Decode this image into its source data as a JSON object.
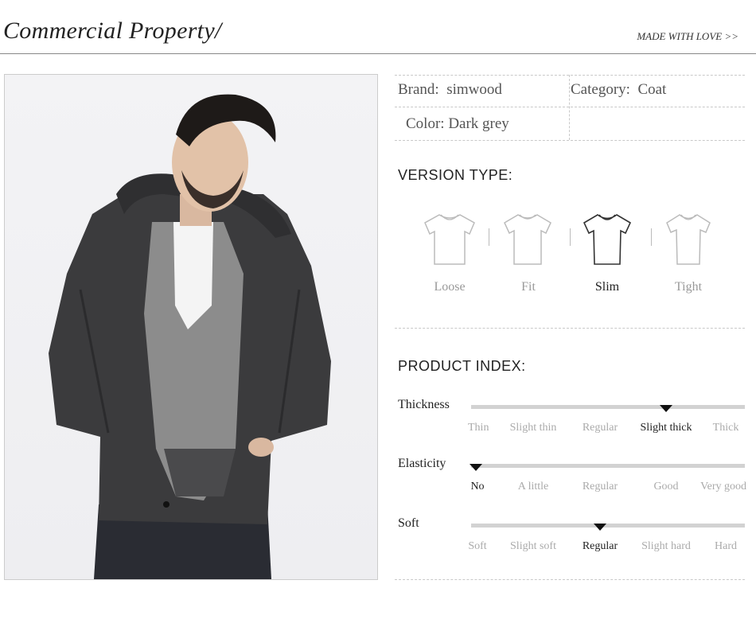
{
  "header": {
    "title": "Commercial Property/",
    "tagline": "MADE WITH LOVE >>"
  },
  "info": {
    "brand_label": "Brand:",
    "brand_value": "simwood",
    "category_label": "Category:",
    "category_value": "Coat",
    "color_label": "Color:",
    "color_value": "Dark grey"
  },
  "version": {
    "title": "VERSION TYPE:",
    "types": [
      {
        "label": "Loose",
        "active": false
      },
      {
        "label": "Fit",
        "active": false
      },
      {
        "label": "Slim",
        "active": true
      },
      {
        "label": "Tight",
        "active": false
      }
    ]
  },
  "index": {
    "title": "PRODUCT INDEX:",
    "rows": [
      {
        "label": "Thickness",
        "options": [
          "Thin",
          "Slight thin",
          "Regular",
          "Slight thick",
          "Thick"
        ],
        "selected": 3
      },
      {
        "label": "Elasticity",
        "options": [
          "No",
          "A little",
          "Regular",
          "Good",
          "Very good"
        ],
        "selected": 0
      },
      {
        "label": "Soft",
        "options": [
          "Soft",
          "Slight soft",
          "Regular",
          "Slight hard",
          "Hard"
        ],
        "selected": 2
      }
    ]
  },
  "colors": {
    "coat": "#3a3a3a",
    "cardigan": "#8a8a8a",
    "marker": "#111111",
    "bar": "#d2d2d2"
  }
}
